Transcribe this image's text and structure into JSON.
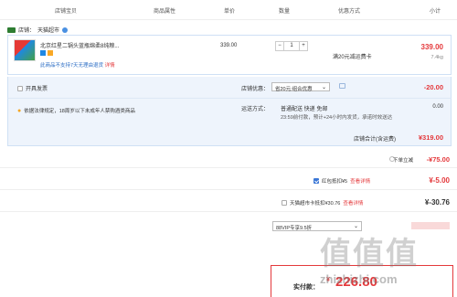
{
  "header": {
    "col_shop_baby": "店铺宝贝",
    "col_attrs": "商品属性",
    "col_price": "单价",
    "col_qty": "数量",
    "col_discount": "优惠方式",
    "col_subtotal": "小计"
  },
  "shop": {
    "label": "店铺：",
    "name": "天猫超市"
  },
  "item": {
    "title": "北京红星二锅头蓝瓶绵柔8纯粮...",
    "note": "此商品不支持7天无理由退货",
    "note_link": "详情",
    "unit_price": "339.00",
    "qty": "1",
    "discount": "满20元减运费卡",
    "subtotal": "339.00",
    "weight": "7.4kg"
  },
  "invoice": {
    "label": "开具发票"
  },
  "shop_discount": {
    "label": "店铺优惠：",
    "value": "省20元:组合优惠",
    "amount": "-20.00"
  },
  "notice": {
    "text": "依据法律规定，18周岁以下未成年人禁购酒类商品"
  },
  "shipping": {
    "label": "运送方式：",
    "method": "普通配送 快递 免邮",
    "detail": "23:59前付款，预计+24小时内发货，承诺时效送达",
    "amount": "0.00"
  },
  "shop_total": {
    "label": "店铺合计(含运费)",
    "amount": "¥319.00"
  },
  "instant_discount": {
    "label": "下单立减",
    "amount": "-¥75.00"
  },
  "red_packet": {
    "label": "红包抵扣¥5",
    "link": "查看详情",
    "amount": "¥-5.00"
  },
  "tmall_card": {
    "label": "天猫超市卡抵扣¥30.76",
    "link": "查看详情",
    "amount": "¥-30.76"
  },
  "vip": {
    "value": "88VIP专享9.5折"
  },
  "total": {
    "label": "实付款：",
    "amount": "226.80"
  },
  "watermark": {
    "text": "zhizhizhi.com",
    "glyphs": "值值值"
  }
}
